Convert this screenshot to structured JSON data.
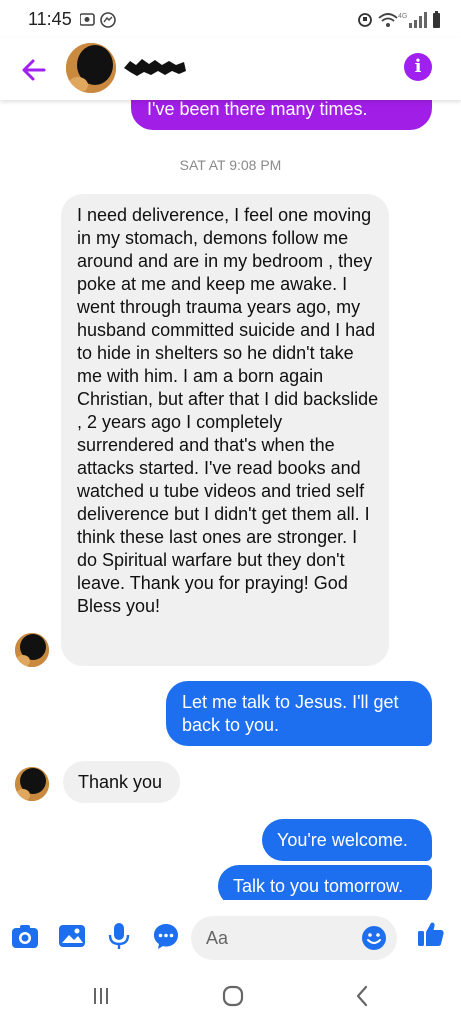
{
  "status_bar": {
    "time": "11:45"
  },
  "header": {},
  "conversation": {
    "messages": [
      {
        "text": "I've been there many times."
      },
      {
        "text": "I need deliverence, I feel one moving in my stomach,  demons follow me around and are in my bedroom , they poke at me and keep me  awake.  I went through trauma years ago, my husband committed suicide and I had to hide in shelters  so he didn't take me with him.   I am a born again Christian, but after that I did backslide , 2 years ago I completely surrendered and that's when the attacks started. I've read books and watched u tube videos and tried self deliverence but I didn't get them all.  I think  these last ones are stronger.  I do Spiritual warfare but they don't leave. Thank you for praying! God Bless you!"
      },
      {
        "text": "Let me talk to Jesus.  I'll get back to you."
      },
      {
        "text": "Thank you"
      },
      {
        "text": "You're welcome."
      },
      {
        "text": "Talk to you tomorrow."
      }
    ],
    "timestamp": "SAT AT 9:08 PM"
  },
  "composer": {
    "placeholder": "Aa"
  },
  "colors": {
    "purple": "#a11ee6",
    "blue": "#1d6ff0",
    "gray_bubble": "#f0f0f0",
    "accent": "#1d6ff0",
    "header_accent": "#a020f0"
  },
  "icons": [
    "back-arrow-icon",
    "info-icon",
    "camera-icon",
    "gallery-icon",
    "microphone-icon",
    "chat-more-icon",
    "emoji-icon",
    "thumbs-up-icon",
    "recent-apps-icon",
    "home-icon",
    "back-nav-icon"
  ]
}
